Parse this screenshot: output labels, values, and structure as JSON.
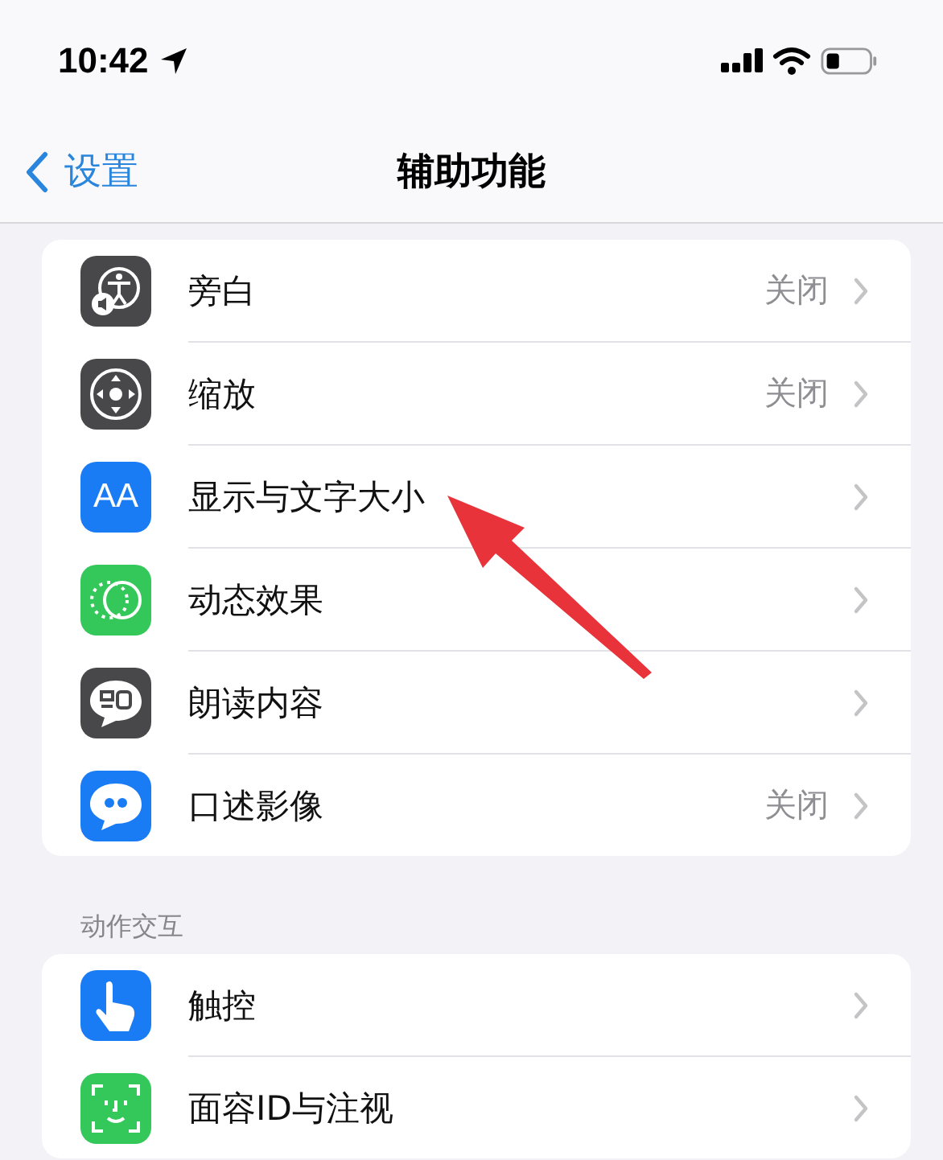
{
  "status_bar": {
    "time": "10:42"
  },
  "nav": {
    "back": "设置",
    "title": "辅助功能"
  },
  "groups": [
    {
      "rows": [
        {
          "kind": "voiceover",
          "label": "旁白",
          "value": "关闭"
        },
        {
          "kind": "zoom",
          "label": "缩放",
          "value": "关闭"
        },
        {
          "kind": "text",
          "icon_text": "AA",
          "label": "显示与文字大小"
        },
        {
          "kind": "motion",
          "label": "动态效果"
        },
        {
          "kind": "speech",
          "label": "朗读内容"
        },
        {
          "kind": "audiodesc",
          "label": "口述影像",
          "value": "关闭"
        }
      ]
    },
    {
      "header": "动作交互",
      "rows": [
        {
          "kind": "touch",
          "label": "触控"
        },
        {
          "kind": "faceid",
          "label": "面容ID与注视"
        }
      ]
    }
  ],
  "annotation": {
    "kind": "arrow"
  }
}
